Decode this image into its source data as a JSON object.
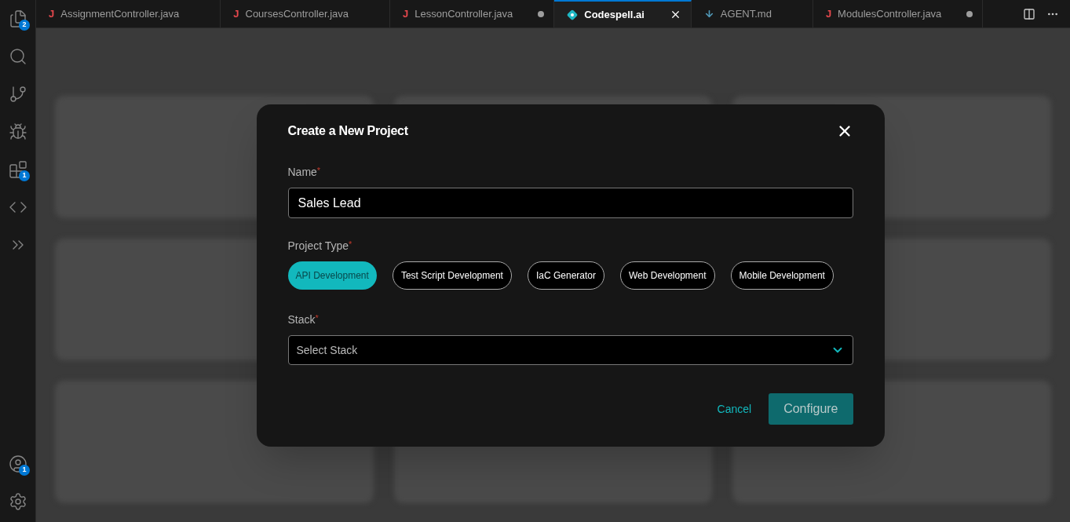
{
  "activity_bar": {
    "items": [
      {
        "kind": "files",
        "badge": "2"
      },
      {
        "kind": "search"
      },
      {
        "kind": "branch"
      },
      {
        "kind": "debug"
      },
      {
        "kind": "extensions",
        "badge": "1"
      },
      {
        "kind": "code"
      },
      {
        "kind": "chevrons"
      }
    ],
    "bottom": [
      {
        "kind": "account",
        "badge": "1"
      },
      {
        "kind": "settings"
      }
    ]
  },
  "tabs": [
    {
      "label": "AssignmentController.java",
      "kind": "java",
      "glyph": "J",
      "selected": false,
      "modified": false
    },
    {
      "label": "CoursesController.java",
      "kind": "java",
      "glyph": "J",
      "selected": false,
      "modified": false
    },
    {
      "label": "LessonController.java",
      "kind": "java",
      "glyph": "J",
      "selected": false,
      "modified": true
    },
    {
      "label": "Codespell.ai",
      "kind": "codespell",
      "selected": true,
      "modified": false
    },
    {
      "label": "AGENT.md",
      "kind": "markdown",
      "selected": false,
      "modified": false
    },
    {
      "label": "ModulesController.java",
      "kind": "java",
      "glyph": "J",
      "selected": false,
      "modified": true
    }
  ],
  "dialog": {
    "title": "Create a New Project",
    "name_field": {
      "label": "Name",
      "required_mark": "*",
      "value": "Sales Lead"
    },
    "project_type": {
      "label": "Project Type",
      "required_mark": "*",
      "options": [
        {
          "label": "API Development",
          "selected": true
        },
        {
          "label": "Test Script Development",
          "selected": false
        },
        {
          "label": "IaC Generator",
          "selected": false
        },
        {
          "label": "Web Development",
          "selected": false
        },
        {
          "label": "Mobile Development",
          "selected": false
        }
      ]
    },
    "stack": {
      "label": "Stack",
      "required_mark": "*",
      "placeholder": "Select Stack"
    },
    "buttons": {
      "cancel": "Cancel",
      "configure": "Configure"
    }
  }
}
